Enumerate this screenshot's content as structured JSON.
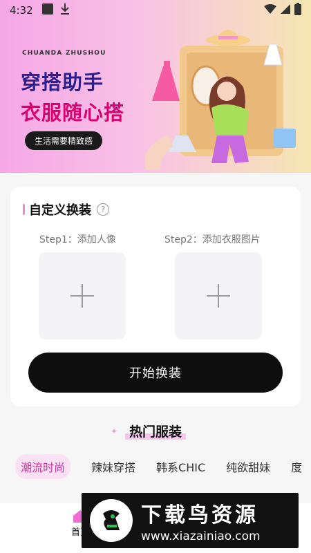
{
  "status_bar": {
    "time": "4:32",
    "icons": [
      "notification-square-icon",
      "download-icon",
      "wifi-icon",
      "signal-icon",
      "battery-icon"
    ]
  },
  "banner": {
    "subtitle": "CHUANDA ZHUSHOU",
    "title_line1": "穿搭助手",
    "title_line2": "衣服随心搭",
    "tagline": "生活需要精致感"
  },
  "custom_outfit": {
    "title": "自定义换装",
    "help_glyph": "?",
    "step1_label": "Step1：添加人像",
    "step2_label": "Step2：添加衣服图片",
    "start_button": "开始换装"
  },
  "hot": {
    "title": "热门服装",
    "tabs": [
      "潮流时尚",
      "辣妹穿搭",
      "韩系CHIC",
      "纯欲甜妹",
      "度"
    ],
    "active_index": 0
  },
  "bottom_nav": {
    "home_label": "首页"
  },
  "watermark": {
    "title": "下载鸟资源",
    "url": "www.xiazainiao.com"
  },
  "colors": {
    "accent_pink": "#d0369f",
    "button_black": "#0e0e0e",
    "title_blue": "#2a1f8c",
    "title_magenta": "#d9006f"
  }
}
